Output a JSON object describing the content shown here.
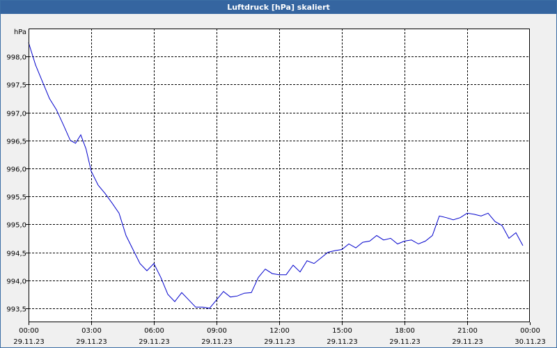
{
  "window": {
    "title": "Luftdruck [hPa] skaliert"
  },
  "colors": {
    "title_bar": "#3565a0",
    "title_text": "#ffffff",
    "plot_background": "#ffffff",
    "series_line": "#0000cc",
    "grid": "#000000"
  },
  "chart_data": {
    "type": "line",
    "ylabel": "hPa",
    "ylim": [
      993.25,
      998.5
    ],
    "xlim": [
      "29.11.23 00:00",
      "30.11.23 00:00"
    ],
    "grid": true,
    "grid_style": "dashed",
    "legend": "none",
    "y_ticks": [
      "993,5",
      "994,0",
      "994,5",
      "995,0",
      "995,5",
      "996,0",
      "996,5",
      "997,0",
      "997,5",
      "998,0"
    ],
    "x_ticks": [
      {
        "time": "00:00",
        "date": "29.11.23"
      },
      {
        "time": "03:00",
        "date": "29.11.23"
      },
      {
        "time": "06:00",
        "date": "29.11.23"
      },
      {
        "time": "09:00",
        "date": "29.11.23"
      },
      {
        "time": "12:00",
        "date": "29.11.23"
      },
      {
        "time": "15:00",
        "date": "29.11.23"
      },
      {
        "time": "18:00",
        "date": "29.11.23"
      },
      {
        "time": "21:00",
        "date": "29.11.23"
      },
      {
        "time": "00:00",
        "date": "30.11.23"
      }
    ],
    "series": [
      {
        "x": [
          "29.11.23 00:00",
          "29.11.23 00:20",
          "29.11.23 00:40",
          "29.11.23 01:00",
          "29.11.23 01:20",
          "29.11.23 01:40",
          "29.11.23 02:00",
          "29.11.23 02:15",
          "29.11.23 02:30",
          "29.11.23 02:45",
          "29.11.23 03:00",
          "29.11.23 03:20",
          "29.11.23 03:40",
          "29.11.23 04:00",
          "29.11.23 04:20",
          "29.11.23 04:40",
          "29.11.23 05:00",
          "29.11.23 05:20",
          "29.11.23 05:40",
          "29.11.23 06:00",
          "29.11.23 06:20",
          "29.11.23 06:40",
          "29.11.23 07:00",
          "29.11.23 07:20",
          "29.11.23 07:40",
          "29.11.23 08:00",
          "29.11.23 08:20",
          "29.11.23 08:40",
          "29.11.23 09:00",
          "29.11.23 09:20",
          "29.11.23 09:40",
          "29.11.23 10:00",
          "29.11.23 10:20",
          "29.11.23 10:40",
          "29.11.23 11:00",
          "29.11.23 11:20",
          "29.11.23 11:40",
          "29.11.23 12:00",
          "29.11.23 12:20",
          "29.11.23 12:40",
          "29.11.23 13:00",
          "29.11.23 13:20",
          "29.11.23 13:40",
          "29.11.23 14:00",
          "29.11.23 14:20",
          "29.11.23 14:40",
          "29.11.23 15:00",
          "29.11.23 15:20",
          "29.11.23 15:40",
          "29.11.23 16:00",
          "29.11.23 16:20",
          "29.11.23 16:40",
          "29.11.23 17:00",
          "29.11.23 17:20",
          "29.11.23 17:40",
          "29.11.23 18:00",
          "29.11.23 18:20",
          "29.11.23 18:40",
          "29.11.23 19:00",
          "29.11.23 19:20",
          "29.11.23 19:40",
          "29.11.23 20:00",
          "29.11.23 20:20",
          "29.11.23 20:40",
          "29.11.23 21:00",
          "29.11.23 21:20",
          "29.11.23 21:40",
          "29.11.23 22:00",
          "29.11.23 22:20",
          "29.11.23 22:40",
          "29.11.23 23:00",
          "29.11.23 23:20",
          "29.11.23 23:40"
        ],
        "values": [
          998.25,
          997.85,
          997.55,
          997.25,
          997.05,
          996.78,
          996.5,
          996.45,
          996.6,
          996.35,
          995.95,
          995.7,
          995.55,
          995.38,
          995.2,
          994.8,
          994.55,
          994.3,
          994.17,
          994.3,
          994.05,
          993.75,
          993.62,
          993.78,
          993.65,
          993.52,
          993.52,
          993.5,
          993.65,
          993.8,
          993.7,
          993.72,
          993.77,
          993.78,
          994.05,
          994.2,
          994.12,
          994.1,
          994.1,
          994.27,
          994.15,
          994.35,
          994.3,
          994.4,
          994.5,
          994.53,
          994.55,
          994.65,
          994.58,
          994.68,
          994.7,
          994.8,
          994.72,
          994.75,
          994.65,
          994.7,
          994.72,
          994.65,
          994.7,
          994.8,
          995.15,
          995.12,
          995.08,
          995.12,
          995.2,
          995.18,
          995.15,
          995.2,
          995.05,
          994.98,
          994.75,
          994.85,
          994.62
        ]
      }
    ]
  }
}
